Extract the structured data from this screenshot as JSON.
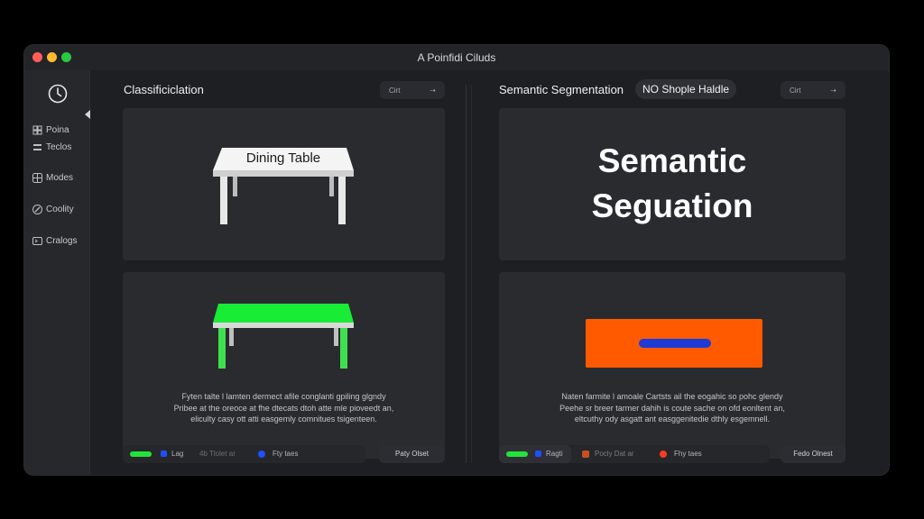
{
  "window": {
    "title": "A Poinfidi Ciluds"
  },
  "sidebar": {
    "items": [
      {
        "label": "Poina",
        "icon": "grid-icon"
      },
      {
        "label": "Teclos",
        "icon": "bars-icon"
      },
      {
        "label": "Modes",
        "icon": "window-icon"
      },
      {
        "label": "Coolity",
        "icon": "pen-icon"
      },
      {
        "label": "Cralogs",
        "icon": "terminal-icon"
      }
    ]
  },
  "left_panel": {
    "title": "Classificiclation",
    "button": {
      "label": "Cirt",
      "arrow": "⇢"
    },
    "top_card": {
      "table_label": "Dining Table"
    },
    "caption": [
      "Fyten talte l lamten dermect afile conglanti gpiling glgndy",
      "Pribee at the oreoce at fhe dtecats dtoh atte mle pioveedt an,",
      "eliculty casy ott atti easgemly comnitues tsigenteen."
    ],
    "legend": {
      "item1": "Lag",
      "item2": "4b Tlolet ar",
      "item3": "Fty taes",
      "end_button": "Paty Olset"
    }
  },
  "right_panel": {
    "title": "Semantic Segmentation",
    "pill": "NO Shople Haldle",
    "button": {
      "label": "Cirt",
      "arrow": "⇢"
    },
    "top_card": {
      "line1": "Semantic",
      "line2": "Seguation"
    },
    "caption": [
      "Naten farmite l amoale Cartsts ail the eogahic so pohc glendy",
      "Peehe sr breer tarmer dahih is coute sache on ofd eonltent an,",
      "eltcuthy ody asgatt ant easggenitedie dthly esgemnell."
    ],
    "legend": {
      "item1": "Ragti",
      "item2": "Pocly Dat ar",
      "item3": "Fhy taes",
      "end_button": "Fedo Olnest"
    }
  },
  "colors": {
    "green": "#22e33a",
    "blue": "#1f4fff",
    "orange": "#ff5a00",
    "red": "#ff3b1f",
    "brown": "#c7501e"
  }
}
